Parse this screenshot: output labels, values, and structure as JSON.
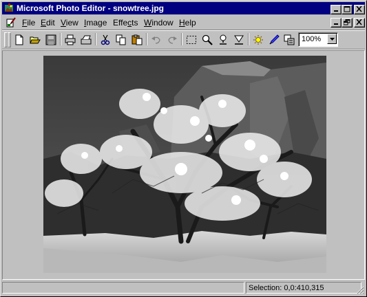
{
  "window": {
    "title": "Microsoft Photo Editor - snowtree.jpg",
    "buttons": [
      "minimize",
      "maximize",
      "close"
    ]
  },
  "menubar": {
    "items": [
      {
        "label": "File",
        "accel": "F"
      },
      {
        "label": "Edit",
        "accel": "E"
      },
      {
        "label": "View",
        "accel": "V"
      },
      {
        "label": "Image",
        "accel": "I"
      },
      {
        "label": "Effects",
        "accel": "c"
      },
      {
        "label": "Window",
        "accel": "W"
      },
      {
        "label": "Help",
        "accel": "H"
      }
    ],
    "doc_buttons": [
      "minimize",
      "restore",
      "close"
    ]
  },
  "toolbar": {
    "icons": [
      "new-icon",
      "open-icon",
      "save-icon",
      "print-icon",
      "scan-icon",
      "cut-icon",
      "copy-icon",
      "paste-icon",
      "undo-icon",
      "redo-icon",
      "select-icon",
      "zoom-icon",
      "smudge-icon",
      "sharpen-icon",
      "auto-balance-icon",
      "eyedropper-icon",
      "properties-icon"
    ],
    "zoom_value": "100%"
  },
  "canvas": {
    "image_name": "snowtree.jpg"
  },
  "statusbar": {
    "message": "",
    "selection": "Selection: 0,0:410,315"
  },
  "colors": {
    "title_active": "#000080",
    "face": "#c0c0c0",
    "shadow": "#808080",
    "highlight": "#ffffff"
  }
}
